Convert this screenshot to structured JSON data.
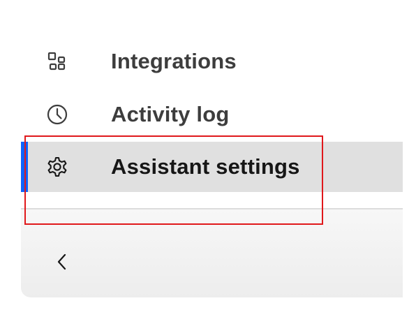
{
  "sidebar": {
    "items": [
      {
        "label": "Integrations",
        "icon": "integrations-icon",
        "active": false
      },
      {
        "label": "Activity log",
        "icon": "clock-icon",
        "active": false
      },
      {
        "label": "Assistant settings",
        "icon": "gear-icon",
        "active": true
      }
    ],
    "collapse_icon": "chevron-left-icon"
  },
  "colors": {
    "active_indicator": "#0f62fe",
    "active_background": "#e0e0e0",
    "highlight_outline": "#e0181b",
    "text": "#3d3d3d"
  }
}
